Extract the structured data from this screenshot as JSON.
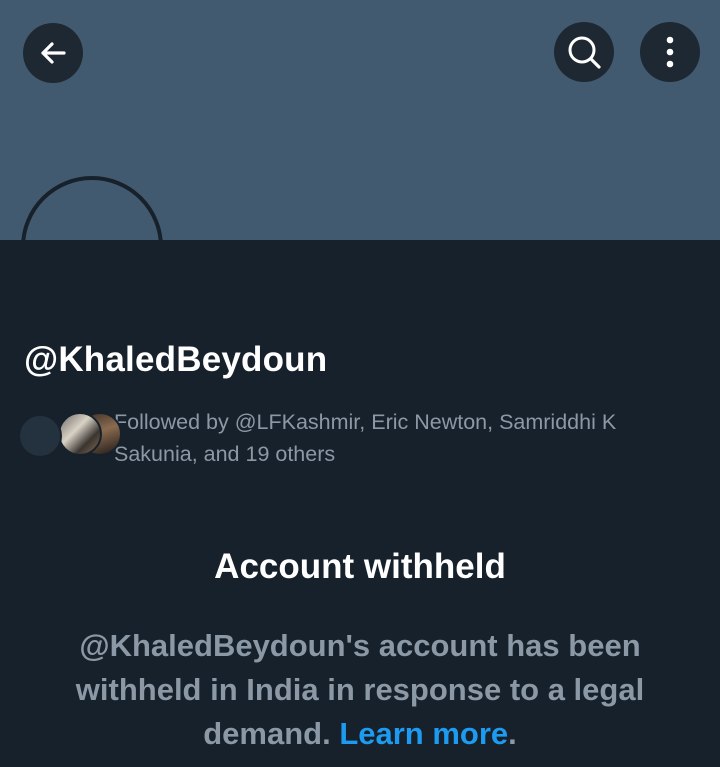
{
  "header": {
    "back_icon": "back-arrow-icon",
    "search_icon": "search-icon",
    "more_icon": "more-vertical-icon"
  },
  "profile": {
    "handle": "@KhaledBeydoun",
    "followed_by": "Followed by @LFKashmir, Eric Newton, Samriddhi K Sakunia, and 19 others"
  },
  "withheld": {
    "title": "Account withheld",
    "message": "@KhaledBeydoun's account has been withheld in India in response to a legal demand.",
    "learn_more": "Learn more",
    "period": "."
  },
  "colors": {
    "banner": "#425a6f",
    "background": "#17212b",
    "accent": "#1d9bf0",
    "secondary_text": "#8b98a5"
  }
}
